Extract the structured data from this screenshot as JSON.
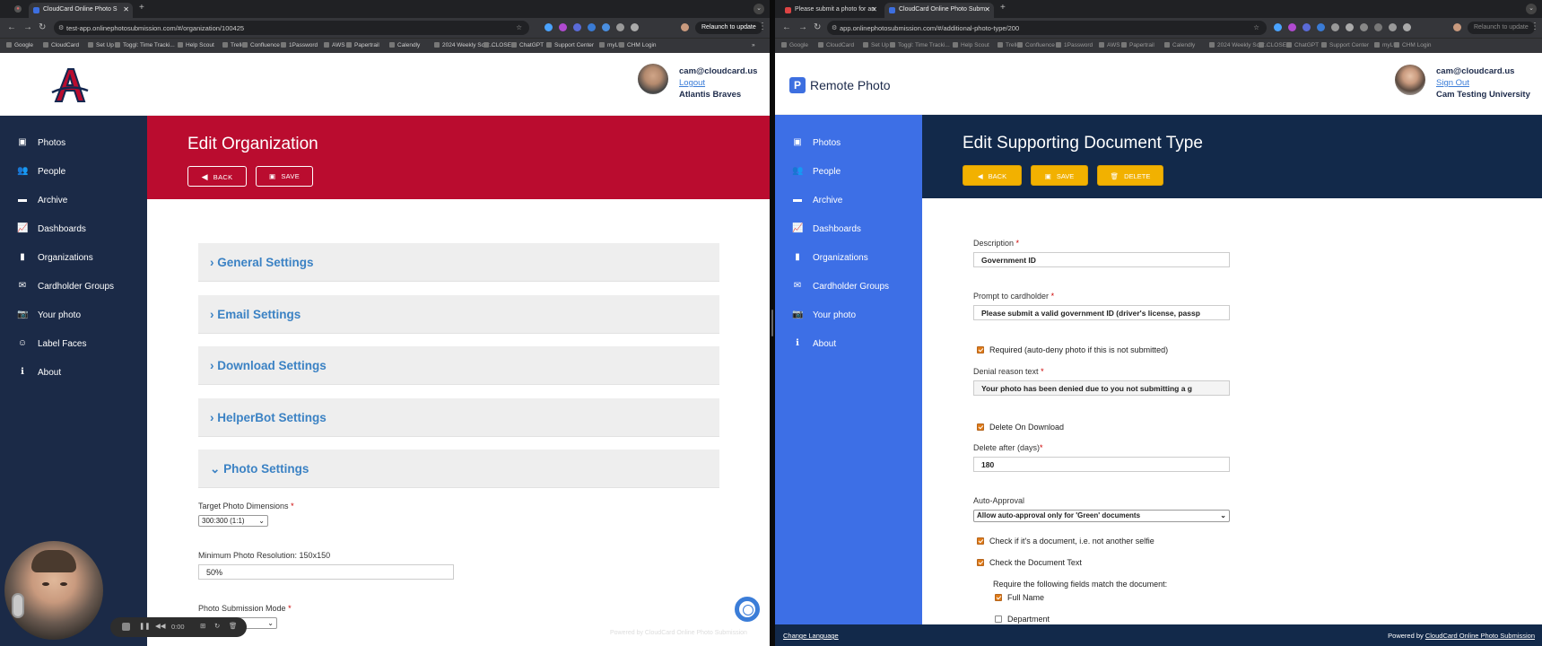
{
  "left": {
    "browser": {
      "tab_title": "CloudCard Online Photo S",
      "url": "test-app.onlinephotosubmission.com/#/organization/100425",
      "relaunch": "Relaunch to update",
      "bookmarks": [
        "Google",
        "CloudCard",
        "Set Up",
        "Toggl: Time Tracki...",
        "Help Scout",
        "Trello",
        "Confluence",
        "1Password",
        "AWS",
        "Papertrail",
        "Calendly",
        "2024 Weekly Scor...",
        "CLOSE",
        "ChatGPT",
        "Support Center",
        "myLU",
        "CHM Login"
      ],
      "more": "»"
    },
    "header": {
      "user_email": "cam@cloudcard.us",
      "logout": "Logout",
      "org": "Atlantis Braves",
      "logo_letter": "A"
    },
    "sidebar": [
      {
        "icon": "photos-icon",
        "glyph": "▣",
        "label": "Photos"
      },
      {
        "icon": "people-icon",
        "glyph": "👥",
        "label": "People"
      },
      {
        "icon": "archive-icon",
        "glyph": "▬",
        "label": "Archive"
      },
      {
        "icon": "dashboards-icon",
        "glyph": "📈",
        "label": "Dashboards"
      },
      {
        "icon": "organizations-icon",
        "glyph": "▮",
        "label": "Organizations"
      },
      {
        "icon": "cardholder-groups-icon",
        "glyph": "✉",
        "label": "Cardholder Groups"
      },
      {
        "icon": "camera-icon",
        "glyph": "📷",
        "label": "Your photo"
      },
      {
        "icon": "label-faces-icon",
        "glyph": "☺",
        "label": "Label Faces"
      },
      {
        "icon": "info-icon",
        "glyph": "ℹ",
        "label": "About"
      }
    ],
    "banner": {
      "title": "Edit Organization",
      "back": "BACK",
      "save": "SAVE"
    },
    "sections": [
      {
        "label": "General Settings",
        "chevron": "›"
      },
      {
        "label": "Email Settings",
        "chevron": "›"
      },
      {
        "label": "Download Settings",
        "chevron": "›"
      },
      {
        "label": "HelperBot Settings",
        "chevron": "›"
      },
      {
        "label": "Photo Settings",
        "chevron": "⌄"
      }
    ],
    "photo_settings": {
      "target_label": "Target Photo Dimensions",
      "target_value": "300:300 (1:1)",
      "min_res_label": "Minimum Photo Resolution: 150x150",
      "min_res_value": "50%",
      "mode_label": "Photo Submission Mode",
      "required_mark": "*"
    },
    "footer_faint": "Powered by CloudCard Online Photo Submission",
    "recording": {
      "time": "0:00"
    }
  },
  "right": {
    "browser": {
      "tab1_title": "Please submit a photo for an",
      "tab2_title": "CloudCard Online Photo Subm",
      "url": "app.onlinephotosubmission.com/#/additional-photo-type/200",
      "relaunch": "Relaunch to update",
      "bookmarks": [
        "Google",
        "CloudCard",
        "Set Up",
        "Toggl: Time Tracki...",
        "Help Scout",
        "Trello",
        "Confluence",
        "1Password",
        "AWS",
        "Papertrail",
        "Calendly",
        "2024 Weekly Scor...",
        "CLOSE",
        "ChatGPT",
        "Support Center",
        "myLU",
        "CHM Login"
      ]
    },
    "header": {
      "brand": "Remote Photo",
      "brand_icon": "P",
      "user_email": "cam@cloudcard.us",
      "signout": "Sign Out",
      "org": "Cam Testing University"
    },
    "sidebar": [
      {
        "icon": "photos-icon",
        "glyph": "▣",
        "label": "Photos"
      },
      {
        "icon": "people-icon",
        "glyph": "👥",
        "label": "People"
      },
      {
        "icon": "archive-icon",
        "glyph": "▬",
        "label": "Archive"
      },
      {
        "icon": "dashboards-icon",
        "glyph": "📈",
        "label": "Dashboards"
      },
      {
        "icon": "organizations-icon",
        "glyph": "▮",
        "label": "Organizations"
      },
      {
        "icon": "cardholder-groups-icon",
        "glyph": "✉",
        "label": "Cardholder Groups"
      },
      {
        "icon": "camera-icon",
        "glyph": "📷",
        "label": "Your photo"
      },
      {
        "icon": "info-icon",
        "glyph": "ℹ",
        "label": "About"
      }
    ],
    "banner": {
      "title": "Edit Supporting Document Type",
      "back": "BACK",
      "save": "SAVE",
      "delete": "DELETE"
    },
    "form": {
      "description_label": "Description",
      "description_value": "Government ID",
      "prompt_label": "Prompt to cardholder",
      "prompt_value": "Please submit a valid government ID (driver's license, passp",
      "required_text": "Required (auto-deny photo if this is not submitted)",
      "denial_label": "Denial reason text",
      "denial_value": "Your photo has been denied due to you not submitting a g",
      "delete_download_text": "Delete On Download",
      "delete_after_label": "Delete after (days)",
      "delete_after_value": "180",
      "auto_approval_label": "Auto-Approval",
      "auto_approval_value": "Allow auto-approval only for 'Green' documents",
      "check_document_text": "Check if it's a document, i.e. not another selfie",
      "check_text_text": "Check the Document Text",
      "require_fields_text": "Require the following fields match the document:",
      "full_name_text": "Full Name",
      "department_text": "Department",
      "required_mark": "*"
    },
    "footer": {
      "change_language": "Change Language",
      "powered_prefix": "Powered by",
      "powered_link": "CloudCard Online Photo Submission"
    }
  },
  "colors": {
    "braves_red": "#ba0c2f",
    "navy": "#1b2a47",
    "link_blue": "#3b82c4",
    "remote_blue": "#3d6fe6",
    "dark_navy": "#12294a",
    "gold": "#f2b100"
  }
}
